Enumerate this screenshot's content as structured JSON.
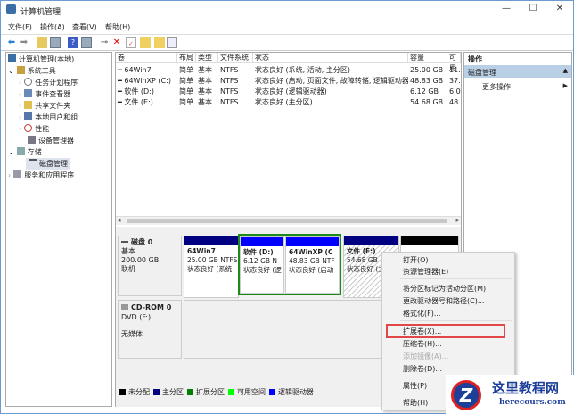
{
  "window": {
    "title": "计算机管理",
    "min": "—",
    "max": "☐",
    "close": "✕"
  },
  "menu": [
    "文件(F)",
    "操作(A)",
    "查看(V)",
    "帮助(H)"
  ],
  "tree": {
    "root": "计算机管理(本地)",
    "system_tools": "系统工具",
    "task_scheduler": "任务计划程序",
    "event_viewer": "事件查看器",
    "shared_folders": "共享文件夹",
    "local_users": "本地用户和组",
    "performance": "性能",
    "device_manager": "设备管理器",
    "storage": "存储",
    "disk_management": "磁盘管理",
    "services": "服务和应用程序"
  },
  "volumes": {
    "headers": [
      "卷",
      "布局",
      "类型",
      "文件系统",
      "状态",
      "容量",
      "可用"
    ],
    "rows": [
      [
        "━ 64Win7",
        "简单",
        "基本",
        "NTFS",
        "状态良好 (系统, 活动, 主分区)",
        "25.00 GB",
        "11."
      ],
      [
        "━ 64WinXP  (C:)",
        "简单",
        "基本",
        "NTFS",
        "状态良好 (启动, 页面文件, 故障转储, 逻辑驱动器)",
        "48.83 GB",
        "37."
      ],
      [
        "━ 软件 (D:)",
        "简单",
        "基本",
        "NTFS",
        "状态良好 (逻辑驱动器)",
        "6.12 GB",
        "6.0"
      ],
      [
        "━ 文件 (E:)",
        "简单",
        "基本",
        "NTFS",
        "状态良好 (主分区)",
        "54.68 GB",
        "48."
      ]
    ]
  },
  "disk0": {
    "name": "磁盘 0",
    "type": "基本",
    "size": "200.00 GB",
    "status": "联机",
    "partitions": [
      {
        "name": "64Win7",
        "size": "25.00 GB NTFS",
        "status": "状态良好 (系统"
      },
      {
        "name": "软件 (D:)",
        "size": "6.12 GB N",
        "status": "状态良好 (逻"
      },
      {
        "name": "64WinXP  (C",
        "size": "48.83 GB NTF",
        "status": "状态良好 (启动"
      },
      {
        "name": "文件 (E:)",
        "size": "54.68 GB N",
        "status": "状态良好 (主"
      }
    ]
  },
  "cdrom": {
    "name": "CD-ROM 0",
    "type": "DVD (F:)",
    "status": "无媒体"
  },
  "legend": [
    {
      "label": "未分配",
      "color": "#000000"
    },
    {
      "label": "主分区",
      "color": "#000080"
    },
    {
      "label": "扩展分区",
      "color": "#008000"
    },
    {
      "label": "可用空间",
      "color": "#00ff00"
    },
    {
      "label": "逻辑驱动器",
      "color": "#0000ff"
    }
  ],
  "actions": {
    "header": "操作",
    "section": "磁盘管理",
    "more": "更多操作"
  },
  "context_menu": {
    "open": "打开(O)",
    "explorer": "资源管理器(E)",
    "mark_active": "将分区标记为活动分区(M)",
    "change_letter": "更改驱动器号和路径(C)...",
    "format": "格式化(F)...",
    "extend": "扩展卷(X)...",
    "shrink": "压缩卷(H)...",
    "add_mirror": "添加镜像(A)...",
    "delete": "删除卷(D)...",
    "properties": "属性(P)",
    "help": "帮助(H)"
  },
  "watermark": {
    "title": "这里教程网",
    "url": "herecours.com"
  }
}
